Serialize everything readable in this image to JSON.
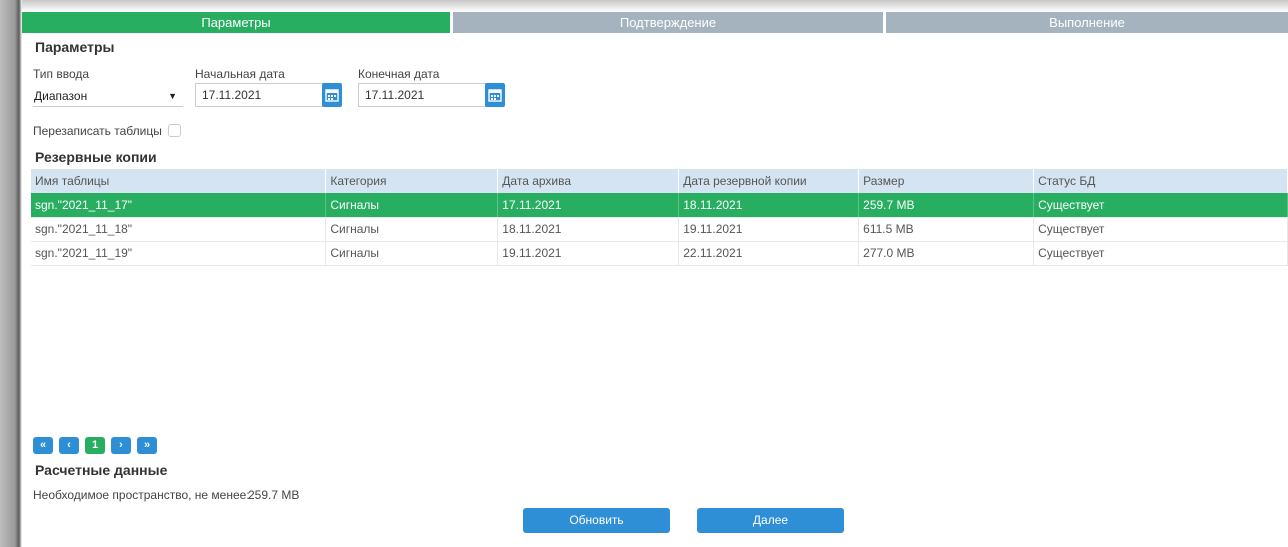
{
  "wizard": {
    "steps": [
      "Параметры",
      "Подтверждение",
      "Выполнение"
    ],
    "active": 0
  },
  "params": {
    "title": "Параметры",
    "input_type_label": "Тип ввода",
    "input_type_value": "Диапазон",
    "start_label": "Начальная дата",
    "start_value": "17.11.2021",
    "end_label": "Конечная дата",
    "end_value": "17.11.2021",
    "overwrite_label": "Перезаписать таблицы"
  },
  "backups": {
    "title": "Резервные копии",
    "columns": [
      "Имя таблицы",
      "Категория",
      "Дата архива",
      "Дата резервной копии",
      "Размер",
      "Статус БД"
    ],
    "rows": [
      [
        "sgn.\"2021_11_17\"",
        "Сигналы",
        "17.11.2021",
        "18.11.2021",
        "259.7 MB",
        "Существует"
      ],
      [
        "sgn.\"2021_11_18\"",
        "Сигналы",
        "18.11.2021",
        "19.11.2021",
        "611.5 MB",
        "Существует"
      ],
      [
        "sgn.\"2021_11_19\"",
        "Сигналы",
        "19.11.2021",
        "22.11.2021",
        "277.0 MB",
        "Существует"
      ]
    ],
    "selected_row": 0
  },
  "pager": {
    "first": "«",
    "prev": "‹",
    "page": "1",
    "next": "›",
    "last": "»"
  },
  "calc": {
    "title": "Расчетные данные",
    "space_label": "Необходимое пространство, не менее:",
    "space_value": "259.7 MB"
  },
  "buttons": {
    "refresh": "Обновить",
    "next": "Далее"
  },
  "colors": {
    "active": "#27ae60",
    "inactive": "#a4b3be",
    "accent": "#2e8fd6",
    "header": "#d4e4f2"
  }
}
